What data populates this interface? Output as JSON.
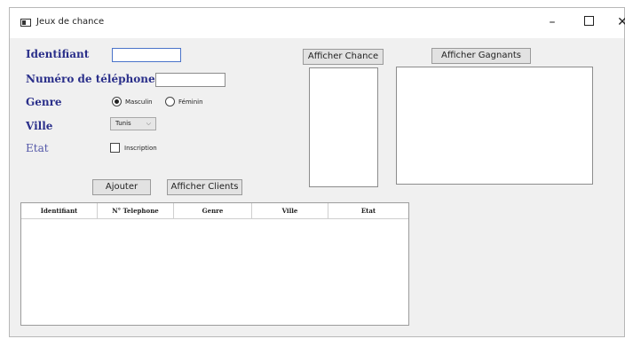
{
  "window": {
    "title": "Jeux de chance"
  },
  "controls": {
    "minimize": "–",
    "close": "✕"
  },
  "form": {
    "identifiant_label": "Identifiant",
    "telephone_label": "Numéro de téléphone",
    "genre_label": "Genre",
    "genre_options": [
      "Masculin",
      "Féminin"
    ],
    "genre_selected": "Masculin",
    "ville_label": "Ville",
    "ville_value": "Tunis",
    "etat_label": "Etat",
    "inscription_label": "Inscription",
    "inscription_checked": false
  },
  "buttons": {
    "ajouter": "Ajouter",
    "afficher_clients": "Afficher Clients",
    "afficher_chance": "Afficher Chance",
    "afficher_gagnants": "Afficher Gagnants"
  },
  "table": {
    "headers": [
      "Identifiant",
      "N° Telephone",
      "Genre",
      "Ville",
      "Etat"
    ],
    "rows": []
  },
  "colors": {
    "label": "#2a2f8a",
    "background": "#f0f0f0"
  }
}
